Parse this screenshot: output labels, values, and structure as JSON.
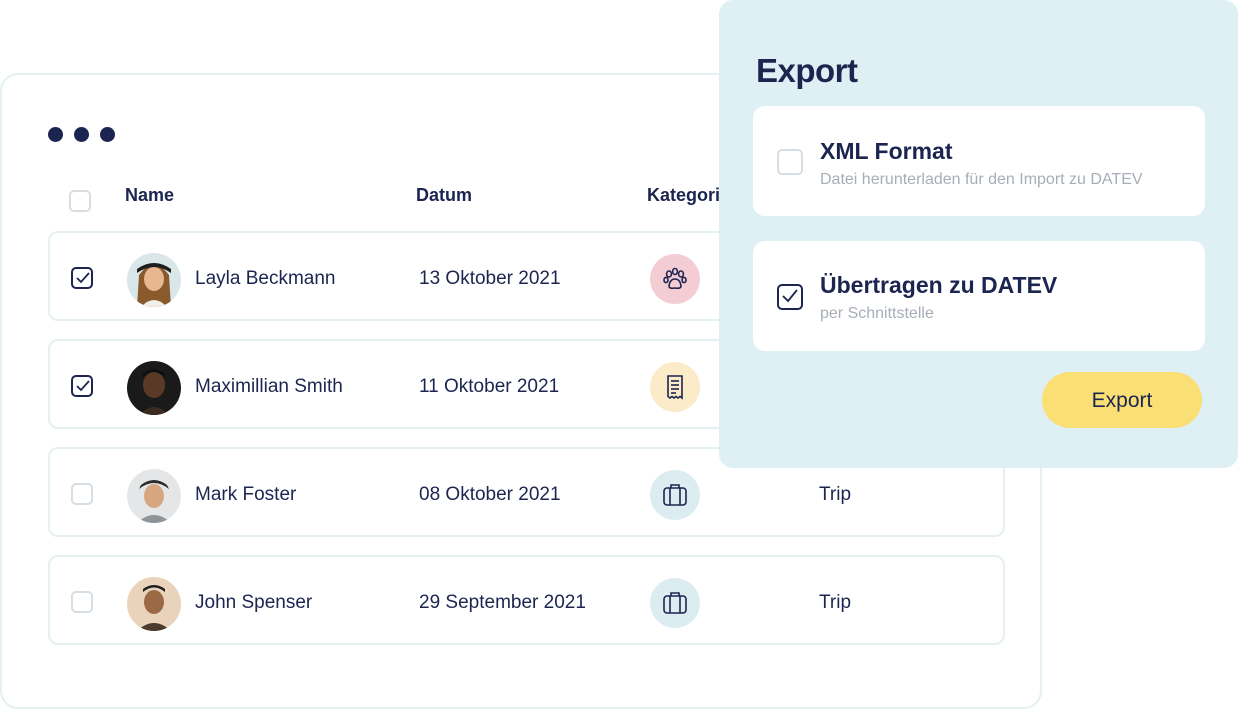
{
  "table": {
    "headers": {
      "name": "Name",
      "date": "Datum",
      "category": "Kategori"
    },
    "rows": [
      {
        "name": "Layla Beckmann",
        "date": "13 Oktober 2021",
        "category_icon": "paw-icon",
        "type": "",
        "checked": true
      },
      {
        "name": "Maximillian Smith",
        "date": "11 Oktober 2021",
        "category_icon": "receipt-icon",
        "type": "",
        "checked": true
      },
      {
        "name": "Mark Foster",
        "date": "08 Oktober 2021",
        "category_icon": "suitcase-icon",
        "type": "Trip",
        "checked": false
      },
      {
        "name": "John Spenser",
        "date": "29 September 2021",
        "category_icon": "suitcase-icon",
        "type": "Trip",
        "checked": false
      }
    ]
  },
  "export": {
    "title": "Export",
    "options": [
      {
        "title": "XML Format",
        "subtitle": "Datei herunterladen für den Import zu DATEV",
        "checked": false
      },
      {
        "title": "Übertragen zu DATEV",
        "subtitle": "per Schnittstelle",
        "checked": true
      }
    ],
    "button_label": "Export"
  },
  "colors": {
    "navy": "#1b2550",
    "panel_bg": "#def0f4",
    "button_bg": "#fadf74",
    "paw_bg": "#f4ccd3",
    "receipt_bg": "#fbebc9",
    "suitcase_bg": "#dcedf2"
  }
}
